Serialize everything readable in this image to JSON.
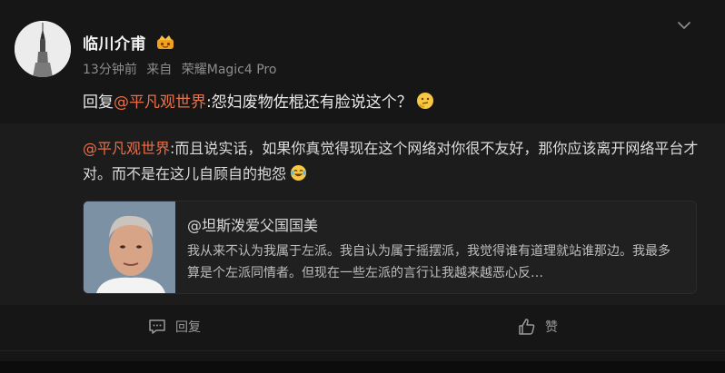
{
  "post": {
    "username": "临川介甫",
    "time": "13分钟前",
    "source_prefix": "来自",
    "source_device": "荣耀Magic4 Pro",
    "reply_prefix": "回复",
    "reply_mention": "@平凡观世界",
    "reply_text": ":怨妇废物佐棍还有脸说这个？"
  },
  "quoted": {
    "mention": "@平凡观世界",
    "text": ":而且说实话，如果你真觉得现在这个网络对你很不友好，那你应该离开网络平台才对。而不是在这儿自顾自的抱怨"
  },
  "embed": {
    "title": "@坦斯泼爱父国国美",
    "text": "我从来不认为我属于左派。我自认为属于摇摆派，我觉得谁有道理就站谁那边。我最多算是个左派同情者。但现在一些左派的言行让我越来越恶心反…"
  },
  "actions": {
    "reply_label": "回复",
    "like_label": "赞"
  },
  "colors": {
    "background": "#161616",
    "mention": "#e8704b",
    "quote_bg": "#1c1c1c"
  },
  "icons": [
    "crown-badge-icon",
    "chevron-down-icon",
    "thinking-face-emoji",
    "laughing-tears-emoji",
    "comment-icon",
    "thumbs-up-icon"
  ]
}
